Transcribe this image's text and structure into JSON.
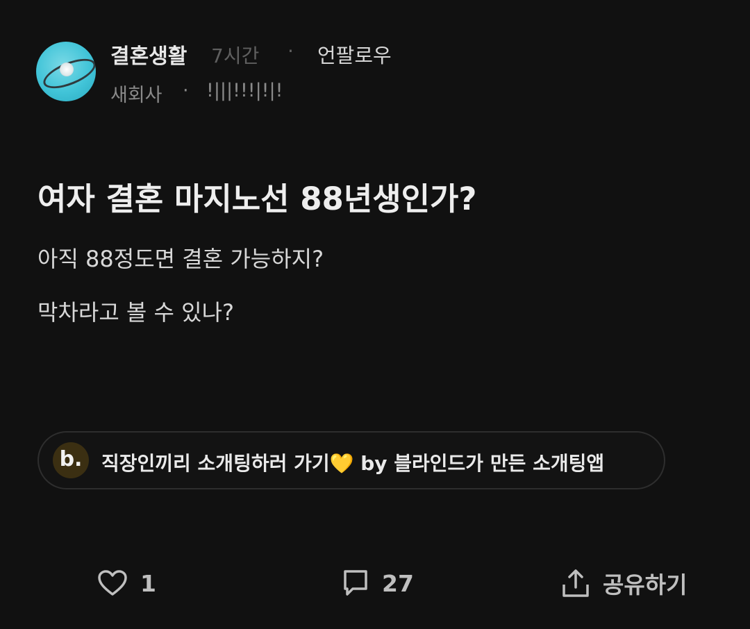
{
  "post": {
    "topic": "결혼생활",
    "time": "7시간",
    "separator": "·",
    "unfollow": "언팔로우",
    "company": "새회사",
    "nickname": "!|||!!!|!|!",
    "title": "여자 결혼 마지노선 88년생인가?",
    "body": [
      "아직 88정도면 결혼 가능하지?",
      "막차라고 볼 수 있나?"
    ]
  },
  "ad": {
    "logo_text": "b.",
    "text": "직장인끼리 소개팅하러 가기💛 by 블라인드가 만든 소개팅앱"
  },
  "actions": {
    "like_count": "1",
    "comment_count": "27",
    "share_label": "공유하기"
  },
  "icons": {
    "like": "heart-icon",
    "comment": "comment-icon",
    "share": "share-icon"
  },
  "colors": {
    "background": "#111111",
    "avatar": "#41c4d8",
    "ad_logo_bg": "#3b2f12"
  }
}
